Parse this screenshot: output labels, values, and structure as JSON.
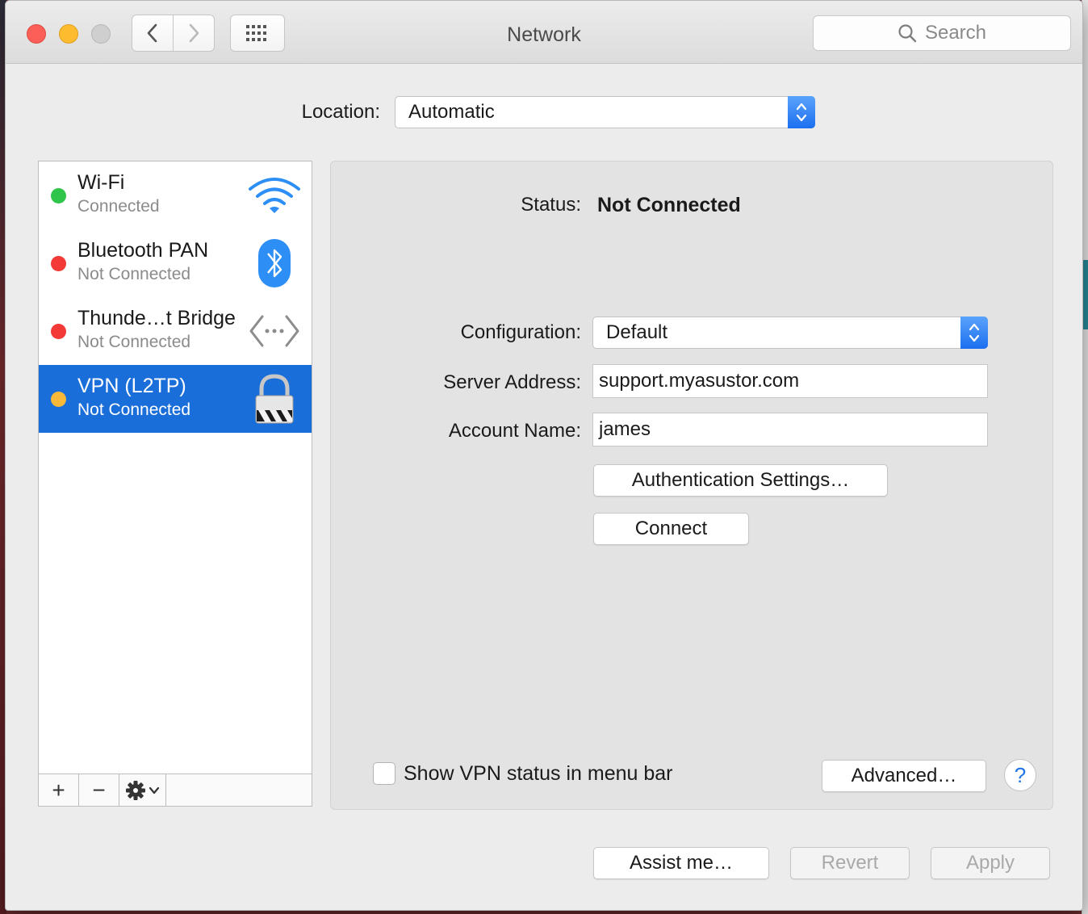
{
  "window": {
    "title": "Network"
  },
  "toolbar": {
    "back_icon": "chevron-left-icon",
    "forward_icon": "chevron-right-icon",
    "show_all_icon": "grid-icon",
    "search_placeholder": "Search"
  },
  "location": {
    "label": "Location:",
    "value": "Automatic"
  },
  "services": [
    {
      "name": "Wi-Fi",
      "status": "Connected",
      "dot_color": "#2fc54a",
      "icon": "wifi-icon",
      "selected": false
    },
    {
      "name": "Bluetooth PAN",
      "status": "Not Connected",
      "dot_color": "#f33a37",
      "icon": "bluetooth-icon",
      "selected": false
    },
    {
      "name": "Thunde…t Bridge",
      "status": "Not Connected",
      "dot_color": "#f33a37",
      "icon": "thunderbolt-bridge-icon",
      "selected": false
    },
    {
      "name": "VPN (L2TP)",
      "status": "Not Connected",
      "dot_color": "#f8b93a",
      "icon": "vpn-lock-icon",
      "selected": true
    }
  ],
  "list_toolbar": {
    "add": "+",
    "remove": "−",
    "gear_icon": "gear-icon"
  },
  "detail": {
    "status_label": "Status:",
    "status_value": "Not Connected",
    "configuration_label": "Configuration:",
    "configuration_value": "Default",
    "server_label": "Server Address:",
    "server_value": "support.myasustor.com",
    "account_label": "Account Name:",
    "account_value": "james",
    "auth_button": "Authentication Settings…",
    "connect_button": "Connect",
    "show_vpn_label": "Show VPN status in menu bar",
    "show_vpn_checked": false,
    "advanced_button": "Advanced…",
    "help_button": "?"
  },
  "footer": {
    "assist_button": "Assist me…",
    "revert_button": "Revert",
    "apply_button": "Apply"
  },
  "colors": {
    "selection": "#1a6ed9",
    "accent": "#1f73e6",
    "close": "#fc5f57",
    "minimize": "#fdbc2f"
  }
}
